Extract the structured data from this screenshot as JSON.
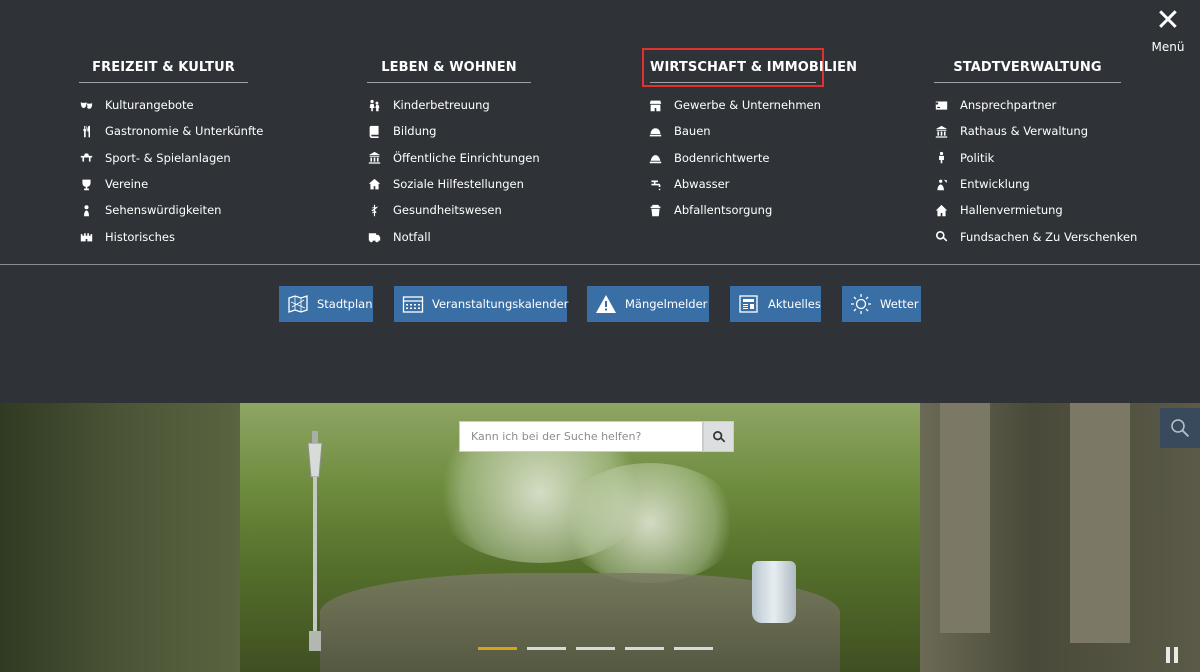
{
  "menu": {
    "close_label": "Menü",
    "close_symbol": "✕",
    "columns": [
      {
        "heading": "FREIZEIT & KULTUR",
        "items": [
          {
            "icon": "theater-masks-icon",
            "label": "Kulturangebote"
          },
          {
            "icon": "fork-knife-icon",
            "label": "Gastronomie & Unterkünfte"
          },
          {
            "icon": "playground-icon",
            "label": "Sport- & Spielanlagen"
          },
          {
            "icon": "trophy-icon",
            "label": "Vereine"
          },
          {
            "icon": "landmark-icon",
            "label": "Sehenswürdigkeiten"
          },
          {
            "icon": "castle-icon",
            "label": "Historisches"
          }
        ]
      },
      {
        "heading": "LEBEN & WOHNEN",
        "items": [
          {
            "icon": "children-icon",
            "label": "Kinderbetreuung"
          },
          {
            "icon": "book-icon",
            "label": "Bildung"
          },
          {
            "icon": "public-building-icon",
            "label": "Öffentliche Einrichtungen"
          },
          {
            "icon": "helping-hands-icon",
            "label": "Soziale Hilfestellungen"
          },
          {
            "icon": "caduceus-icon",
            "label": "Gesundheitswesen"
          },
          {
            "icon": "ambulance-icon",
            "label": "Notfall"
          }
        ]
      },
      {
        "heading": "WIRTSCHAFT & IMMOBILIEN",
        "highlighted": true,
        "items": [
          {
            "icon": "storefront-icon",
            "label": "Gewerbe & Unternehmen"
          },
          {
            "icon": "hard-hat-icon",
            "label": "Bauen"
          },
          {
            "icon": "land-value-icon",
            "label": "Bodenrichtwerte"
          },
          {
            "icon": "faucet-icon",
            "label": "Abwasser"
          },
          {
            "icon": "trash-bin-icon",
            "label": "Abfallentsorgung"
          }
        ]
      },
      {
        "heading": "STADTVERWALTUNG",
        "items": [
          {
            "icon": "contact-card-icon",
            "label": "Ansprechpartner"
          },
          {
            "icon": "town-hall-icon",
            "label": "Rathaus & Verwaltung"
          },
          {
            "icon": "politics-icon",
            "label": "Politik"
          },
          {
            "icon": "development-icon",
            "label": "Entwicklung"
          },
          {
            "icon": "house-icon",
            "label": "Hallenvermietung"
          },
          {
            "icon": "search-icon",
            "label": "Fundsachen & Zu Verschenken"
          }
        ]
      }
    ]
  },
  "quick_links": [
    {
      "icon": "map-icon",
      "label": "Stadtplan"
    },
    {
      "icon": "calendar-icon",
      "label": "Veranstaltungskalender"
    },
    {
      "icon": "warning-icon",
      "label": "Mängelmelder"
    },
    {
      "icon": "newspaper-icon",
      "label": "Aktuelles"
    },
    {
      "icon": "sun-icon",
      "label": "Wetter"
    }
  ],
  "search": {
    "placeholder": "Kann ich bei der Suche helfen?"
  },
  "slider": {
    "slide_count": 5,
    "active_index": 0
  },
  "colors": {
    "menu_background": "#2f3338",
    "quick_link_background": "#3a6fa6",
    "highlight_border": "#e0312f",
    "active_dot": "#d7a418"
  }
}
